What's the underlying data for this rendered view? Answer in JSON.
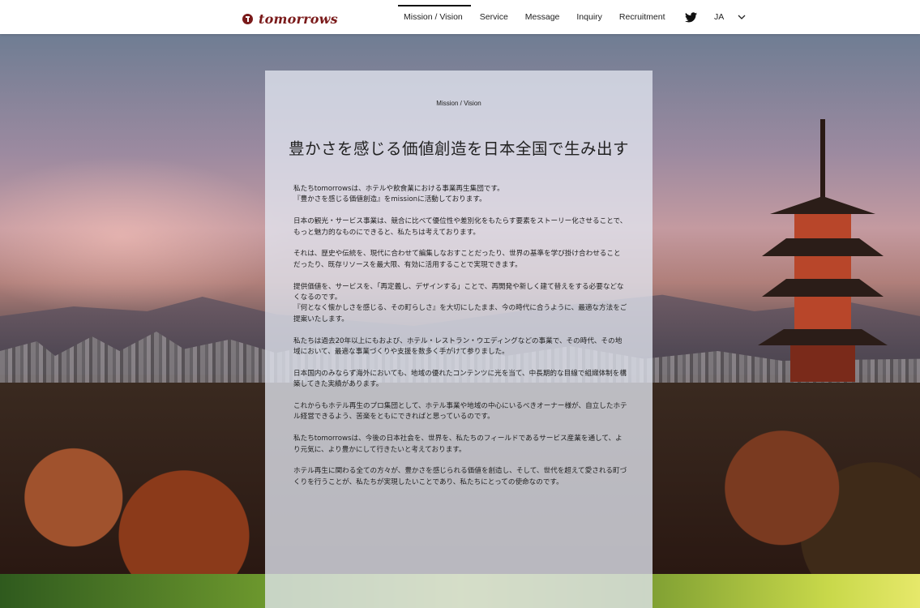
{
  "nav": {
    "logo_text": "tomorrows",
    "items": [
      {
        "label": "Mission / Vision",
        "active": true
      },
      {
        "label": "Service"
      },
      {
        "label": "Message"
      },
      {
        "label": "Inquiry"
      },
      {
        "label": "Recruitment"
      }
    ],
    "social_icon": "twitter-icon",
    "language": "JA",
    "language_icon": "chevron-down-icon"
  },
  "panel": {
    "section_label": "Mission / Vision",
    "heading": "豊かさを感じる価値創造を日本全国で生み出す",
    "paragraphs": [
      "私たちtomorrowsは、ホテルや飲食業における事業再生集団です。\n『豊かさを感じる価値創造』をmissionに活動しております。",
      "日本の観光・サービス事業は、競合に比べて優位性や差別化をもたらす要素をストーリー化させることで、もっと魅力的なものにできると、私たちは考えております。",
      "それは、歴史や伝統を、現代に合わせて編集しなおすことだったり、世界の基準を学び掛け合わせることだったり、既存リソースを最大限、有効に活用することで実現できます。",
      "提供価値を、サービスを、「再定義し、デザインする」ことで、再開発や新しく建て替えをする必要などなくなるのです。\n『何となく懐かしさを感じる、その町らしさ』を大切にしたまま、今の時代に合うように、最適な方法をご提案いたします。",
      "私たちは過去20年以上にもおよび、ホテル・レストラン・ウエディングなどの事業で、その時代、その地域において、最適な事業づくりや支援を数多く手がけて参りました。",
      "日本国内のみならず海外においても、地域の優れたコンテンツに光を当て、中長期的な目線で組織体制を構築してきた実績があります。",
      "これからもホテル再生のプロ集団として、ホテル事業や地域の中心にいるべきオーナー様が、自立したホテル経営できるよう、苦楽をともにできればと思っているのです。",
      "私たちtomorrowsは、今後の日本社会を、世界を、私たちのフィールドであるサービス産業を通して、より元気に、より豊かにして行きたいと考えております。",
      "ホテル再生に関わる全ての方々が、豊かさを感じられる価値を創造し、そして、世代を超えて愛される町づくりを行うことが、私たちが実現したいことであり、私たちにとっての使命なのです。"
    ]
  },
  "colors": {
    "brand": "#7a1a1a",
    "nav_bg": "#ffffff",
    "panel_bg": "rgba(225,230,240,0.78)"
  }
}
